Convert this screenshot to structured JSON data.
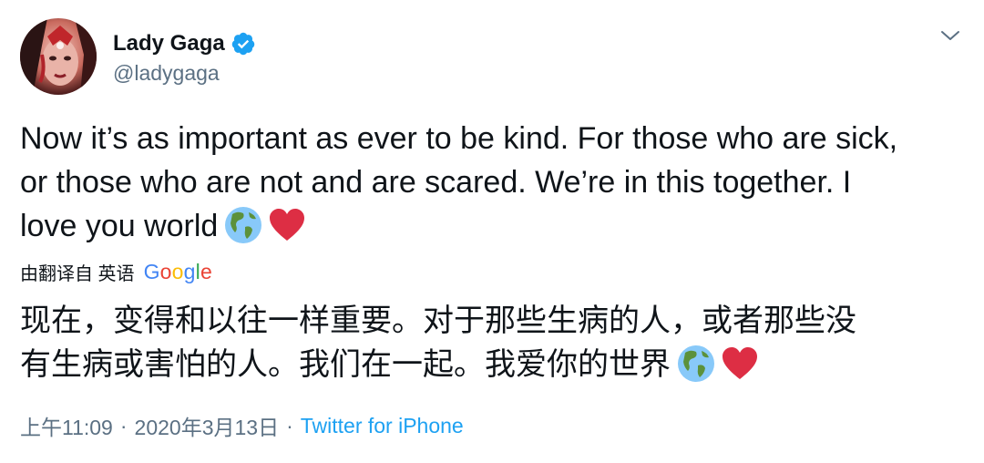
{
  "user": {
    "display_name": "Lady Gaga",
    "handle": "@ladygaga",
    "verified": true,
    "avatar_icon": "profile-photo"
  },
  "tweet": {
    "line1": "Now it’s as important as ever to be kind. For those who are sick,",
    "line2": "or those who are not and are scared. We’re in this together. I",
    "line3": "love you world",
    "emojis": [
      "earth-americas-emoji",
      "red-heart-emoji"
    ]
  },
  "translation": {
    "label": "由翻译自 英语",
    "provider_letters": [
      "G",
      "o",
      "o",
      "g",
      "l",
      "e"
    ],
    "line1": "现在，变得和以往一样重要。对于那些生病的人，或者那些没",
    "line2": "有生病或害怕的人。我们在一起。我爱你的世界"
  },
  "meta": {
    "time": "上午11:09",
    "date": "2020年3月13日",
    "separator": "·",
    "source": "Twitter for iPhone"
  },
  "colors": {
    "text": "#0f1419",
    "secondary": "#5b7083",
    "link": "#1da1f2",
    "verified": "#1da1f2",
    "heart": "#e0245e"
  }
}
